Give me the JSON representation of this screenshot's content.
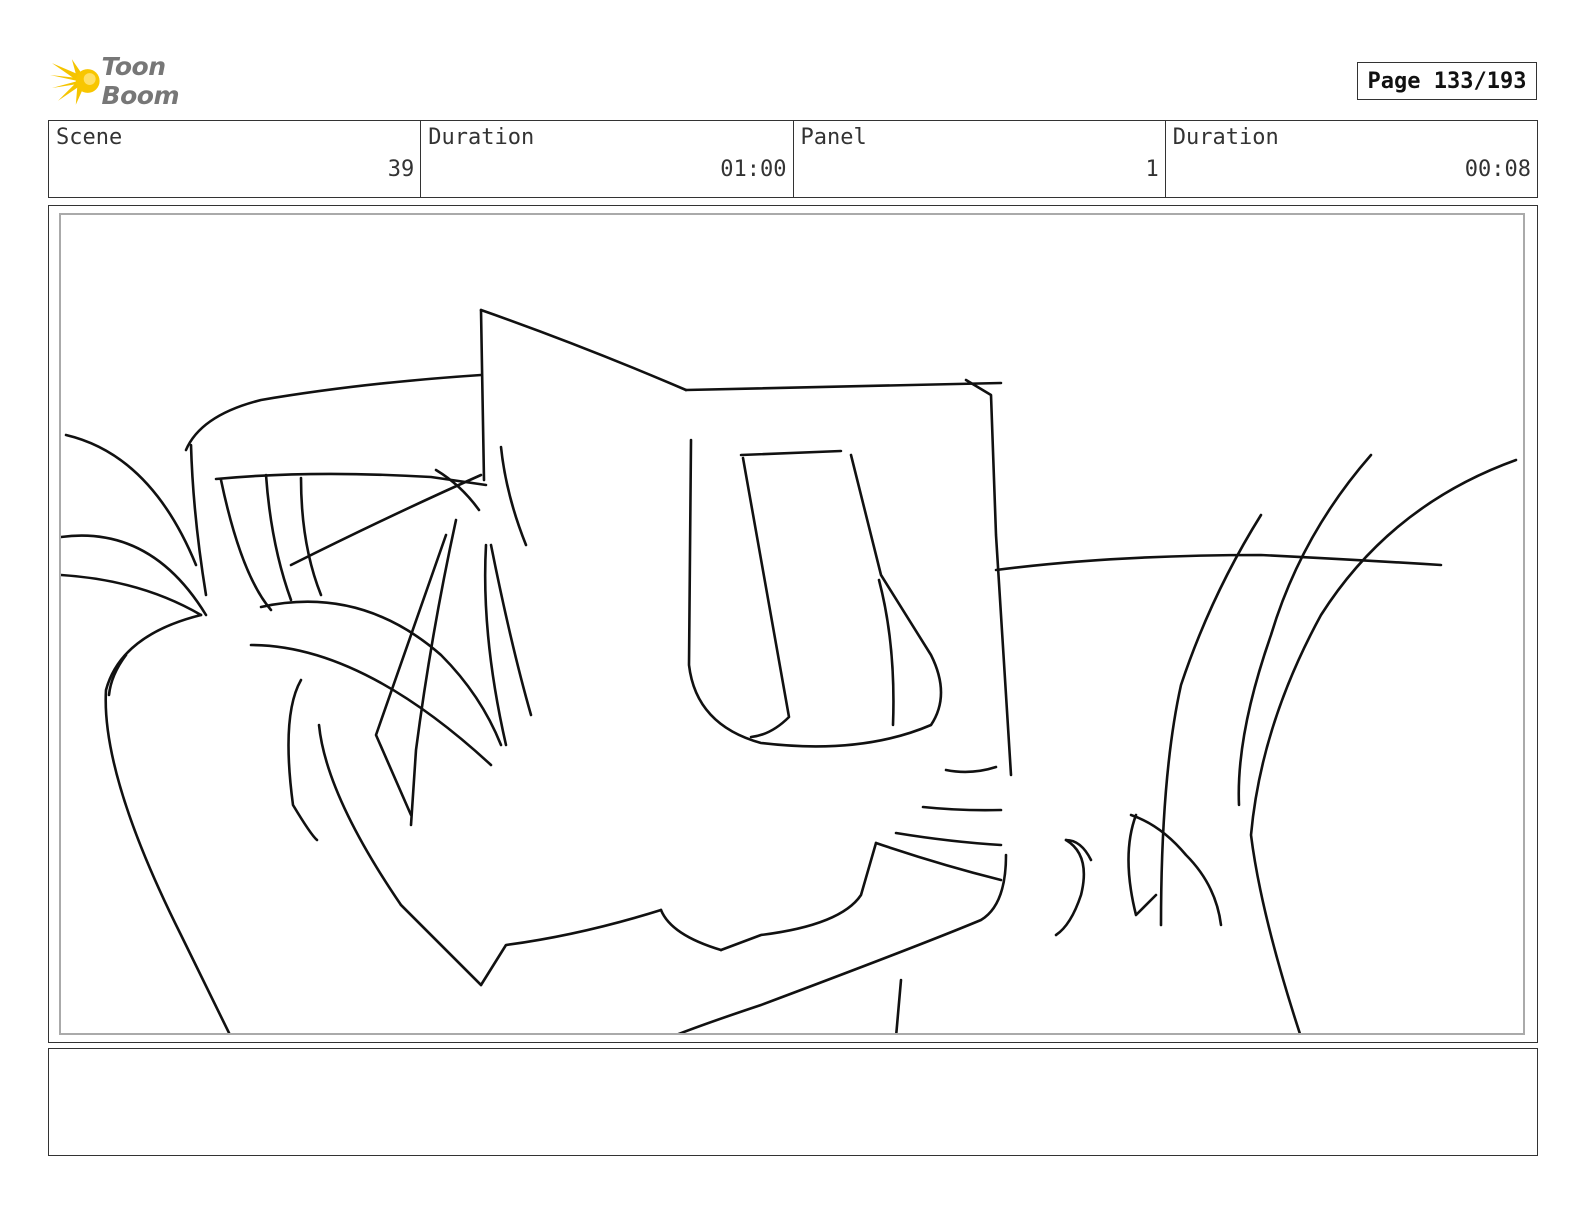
{
  "header": {
    "logo_text": "Toon Boom",
    "page_label": "Page 133/193"
  },
  "info": {
    "scene_label": "Scene",
    "scene_value": "39",
    "scene_duration_label": "Duration",
    "scene_duration_value": "01:00",
    "panel_label": "Panel",
    "panel_value": "1",
    "panel_duration_label": "Duration",
    "panel_duration_value": "00:08"
  },
  "panel": {
    "sketch": "line-drawing-of-cat-face"
  },
  "notes": {
    "text": ""
  },
  "colors": {
    "logo_star": "#f5c400",
    "logo_text": "#777777"
  }
}
